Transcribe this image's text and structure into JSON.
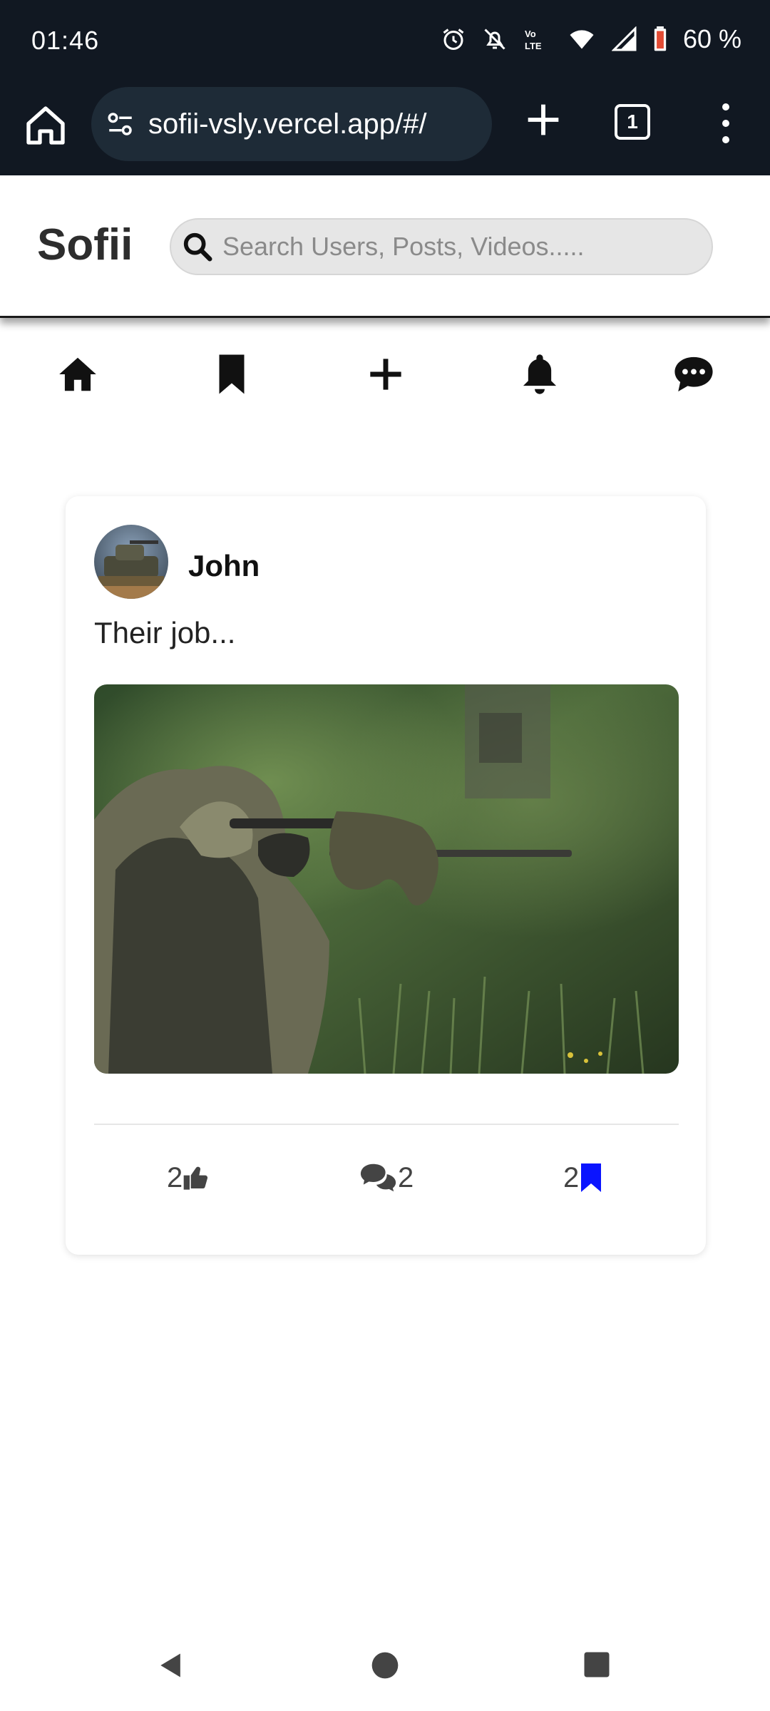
{
  "status_bar": {
    "time": "01:46",
    "battery": "60 %",
    "network_badge": "Vo LTE",
    "icons": [
      "alarm-icon",
      "bell-off-icon",
      "volte-icon",
      "wifi-icon",
      "signal-icon",
      "battery-icon"
    ]
  },
  "browser": {
    "url": "sofii-vsly.vercel.app/#/",
    "tab_count": "1",
    "icons": [
      "home-icon",
      "site-settings-icon",
      "plus-icon",
      "tabs-icon",
      "more-vert-icon"
    ]
  },
  "header": {
    "logo": "Sofii",
    "search_placeholder": "Search Users, Posts, Videos....."
  },
  "nav": {
    "items": [
      "home-icon",
      "bookmark-icon",
      "plus-icon",
      "bell-icon",
      "chat-icon"
    ]
  },
  "post": {
    "author": "John",
    "caption": "Their job...",
    "likes": "2",
    "comments": "2",
    "saves": "2",
    "save_color": "#0a14ff",
    "image_icon": "photo-sniper-in-ghillie-suit"
  },
  "system_nav": {
    "items": [
      "back-icon",
      "home-circle-icon",
      "recents-icon"
    ]
  }
}
